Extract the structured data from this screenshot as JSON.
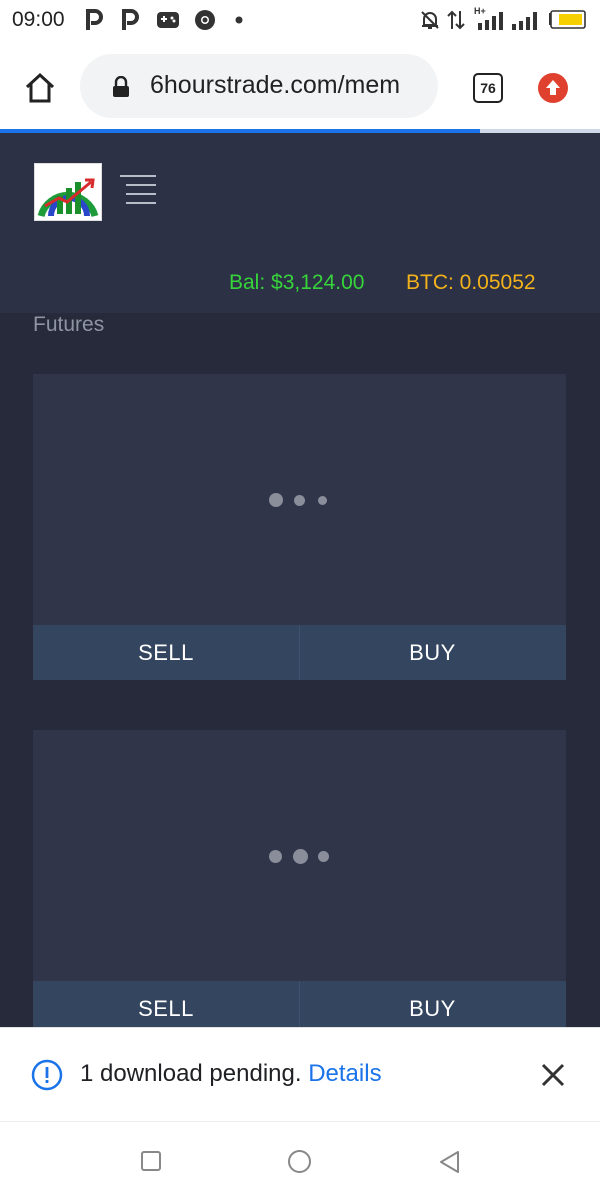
{
  "status_bar": {
    "time": "09:00",
    "network_label": "H+",
    "icons": [
      "pinterest-p-icon",
      "pinterest-p-icon",
      "game-controller-icon",
      "chrome-icon",
      "dot-icon",
      "notifications-off-icon",
      "data-transfer-icon",
      "signal-icon",
      "signal-icon",
      "battery-icon"
    ]
  },
  "browser": {
    "url": "6hourstrade.com/mem",
    "tab_count": "76",
    "accent": "#1a73e8"
  },
  "site": {
    "balance_label": "Bal:  $3,124.00",
    "btc_label": "BTC:  0.05052",
    "balance_color": "#36d43a",
    "btc_color": "#f3b21b",
    "section_title": "Futures"
  },
  "cards": [
    {
      "sell_label": "SELL",
      "buy_label": "BUY"
    },
    {
      "sell_label": "SELL",
      "buy_label": "BUY"
    }
  ],
  "download_banner": {
    "message": "1 download pending.",
    "link": "Details"
  },
  "nav_bar": {
    "icons": [
      "recents-square-icon",
      "home-circle-icon",
      "back-triangle-icon"
    ]
  }
}
